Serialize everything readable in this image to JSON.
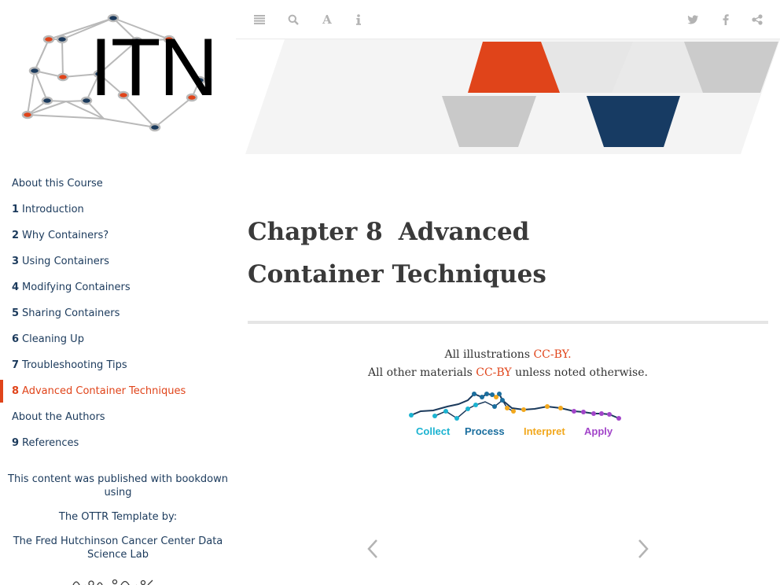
{
  "logo": {
    "text": "ITN"
  },
  "toolbar": {
    "left_icons": [
      "sidebar-toggle-icon",
      "search-icon",
      "font-settings-icon",
      "info-icon"
    ],
    "right_icons": [
      "twitter-icon",
      "facebook-icon",
      "share-icon"
    ]
  },
  "toc": [
    {
      "num": "",
      "label": "About this Course"
    },
    {
      "num": "1",
      "label": "Introduction"
    },
    {
      "num": "2",
      "label": "Why Containers?"
    },
    {
      "num": "3",
      "label": "Using Containers"
    },
    {
      "num": "4",
      "label": "Modifying Containers"
    },
    {
      "num": "5",
      "label": "Sharing Containers"
    },
    {
      "num": "6",
      "label": "Cleaning Up"
    },
    {
      "num": "7",
      "label": "Troubleshooting Tips"
    },
    {
      "num": "8",
      "label": "Advanced Container Techniques",
      "active": true
    },
    {
      "num": "",
      "label": "About the Authors"
    },
    {
      "num": "9",
      "label": "References"
    }
  ],
  "sidebar_notes": {
    "published": "This content was published with bookdown using",
    "template": "The OTTR Template by:",
    "lab": "The Fred Hutchinson Cancer Center Data Science Lab"
  },
  "chapter": {
    "number": "Chapter 8",
    "title": "Advanced Container Techniques"
  },
  "license": {
    "line1_prefix": "All illustrations ",
    "line1_link": "CC-BY.",
    "line2_prefix": "All other materials ",
    "line2_link": "CC-BY",
    "line2_suffix": " unless noted otherwise."
  },
  "pipeline": {
    "stages": [
      "Collect",
      "Process",
      "Interpret",
      "Apply"
    ],
    "colors": [
      "#1bb3d1",
      "#1a6e9e",
      "#f2a81d",
      "#a245c9"
    ]
  },
  "colors": {
    "accent": "#e0441a",
    "navy": "#1b3a5c",
    "gray_icon": "#b3b3b3"
  }
}
